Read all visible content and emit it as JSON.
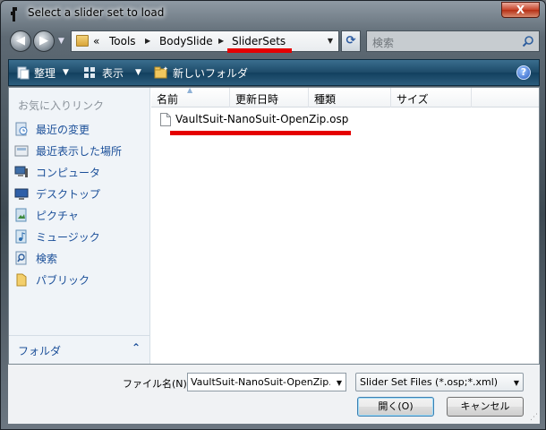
{
  "window": {
    "title": "Select a slider set to load",
    "close_label": "X"
  },
  "address_bar": {
    "overflow": "«",
    "crumbs": [
      "Tools",
      "BodySlide",
      "SliderSets"
    ]
  },
  "search": {
    "placeholder": "検索"
  },
  "toolbar": {
    "organize": "整理",
    "views": "表示",
    "new_folder": "新しいフォルダ"
  },
  "sidebar": {
    "favorites_heading": "お気に入りリンク",
    "items": [
      {
        "label": "最近の変更",
        "icon": "recent-changes-icon"
      },
      {
        "label": "最近表示した場所",
        "icon": "recent-places-icon"
      },
      {
        "label": "コンピュータ",
        "icon": "computer-icon"
      },
      {
        "label": "デスクトップ",
        "icon": "desktop-icon"
      },
      {
        "label": "ピクチャ",
        "icon": "pictures-icon"
      },
      {
        "label": "ミュージック",
        "icon": "music-icon"
      },
      {
        "label": "検索",
        "icon": "search-folder-icon"
      },
      {
        "label": "パブリック",
        "icon": "public-folder-icon"
      }
    ],
    "folders_label": "フォルダ"
  },
  "columns": [
    "名前",
    "更新日時",
    "種類",
    "サイズ"
  ],
  "files": [
    {
      "name": "VaultSuit-NanoSuit-OpenZip.osp"
    }
  ],
  "footer": {
    "filename_label": "ファイル名(N):",
    "filename_value": "VaultSuit-NanoSuit-OpenZip.o",
    "filetype_value": "Slider Set Files (*.osp;*.xml)",
    "open_button": "開く(O)",
    "cancel_button": "キャンセル"
  },
  "colors": {
    "annotation_red": "#e50000",
    "link_blue": "#1b4f99",
    "toolbar_blue": "#1d4a69"
  }
}
